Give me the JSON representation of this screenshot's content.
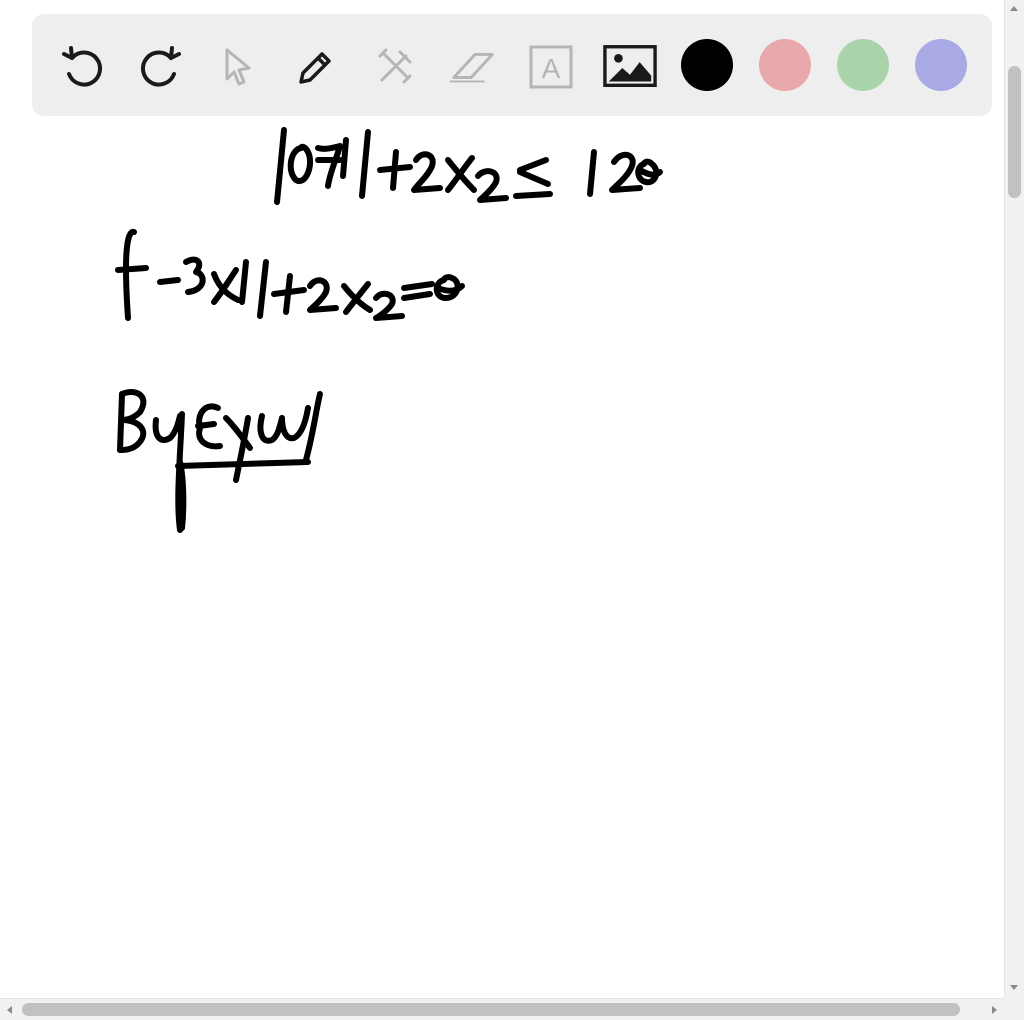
{
  "toolbar": {
    "tools": [
      {
        "name": "undo-icon",
        "enabled": true
      },
      {
        "name": "redo-icon",
        "enabled": true
      },
      {
        "name": "select-pointer-icon",
        "enabled": false
      },
      {
        "name": "pencil-icon",
        "enabled": true
      },
      {
        "name": "tools-cross-icon",
        "enabled": false
      },
      {
        "name": "eraser-icon",
        "enabled": false
      },
      {
        "name": "text-tool-icon",
        "enabled": false
      },
      {
        "name": "insert-image-icon",
        "enabled": true
      }
    ],
    "colors": [
      {
        "name": "color-black",
        "hex": "#000000",
        "selected": true
      },
      {
        "name": "color-pink",
        "hex": "#e8a7aa",
        "selected": false
      },
      {
        "name": "color-green",
        "hex": "#a9d4a9",
        "selected": false
      },
      {
        "name": "color-purple",
        "hex": "#a9a9e6",
        "selected": false
      }
    ],
    "text_tool_glyph": "A"
  },
  "theme": {
    "toolbar_bg": "#eeeeee",
    "icon_active": "#1a1a1a",
    "icon_disabled": "#b5b5b5",
    "ink": "#000000"
  }
}
